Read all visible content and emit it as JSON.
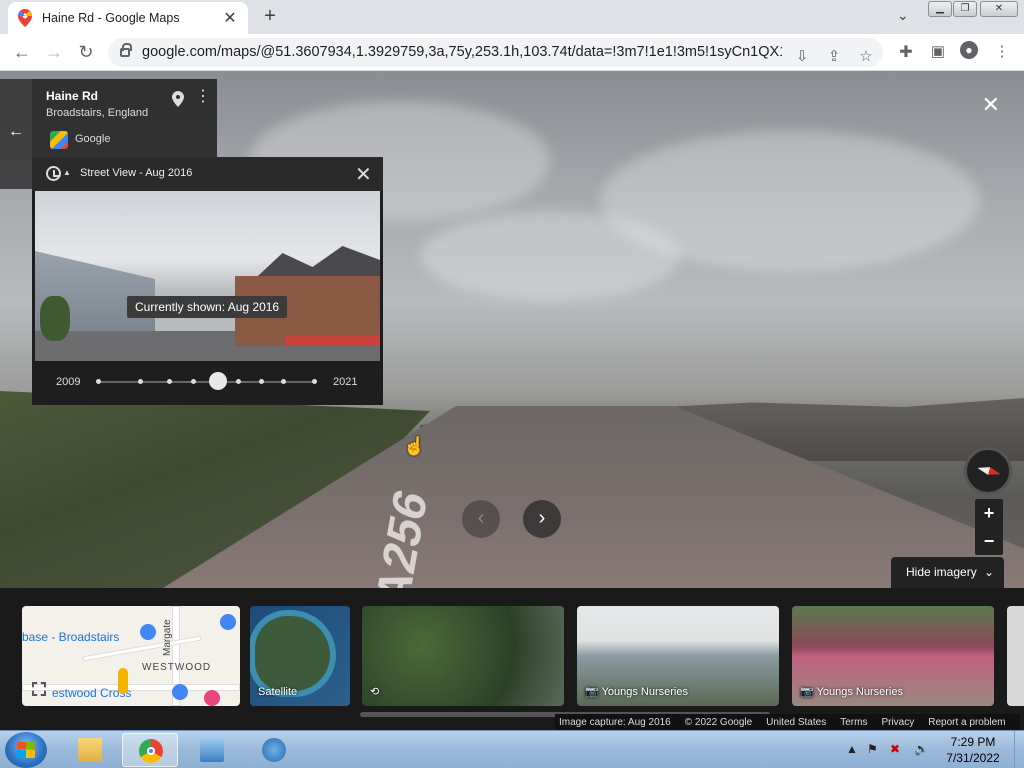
{
  "browser": {
    "tab_title": "Haine Rd - Google Maps",
    "url": "google.com/maps/@51.3607934,1.3929759,3a,75y,253.1h,103.74t/data=!3m7!1e1!3m5!1syCn1QX1db..."
  },
  "place": {
    "name": "Haine Rd",
    "subtitle": "Broadstairs, England",
    "provider": "Google"
  },
  "time_machine": {
    "title": "Street View - Aug 2016",
    "tooltip": "Currently shown: Aug 2016",
    "start_year": "2009",
    "end_year": "2021",
    "selected_fraction": 0.55
  },
  "controls": {
    "hide_imagery": "Hide imagery"
  },
  "filmstrip": {
    "map_labels": [
      "base - Broadstairs",
      "Margate",
      "WESTWOOD",
      "estwood Cross"
    ],
    "satellite": "Satellite",
    "nurseries_1": "Youngs Nurseries",
    "nurseries_2": "Youngs Nurseries"
  },
  "footer": {
    "capture": "Image capture: Aug 2016",
    "copyright": "© 2022 Google",
    "region": "United States",
    "terms": "Terms",
    "privacy": "Privacy",
    "report": "Report a problem"
  },
  "road_marking": "A256",
  "taskbar": {
    "time": "7:29 PM",
    "date": "7/31/2022"
  }
}
